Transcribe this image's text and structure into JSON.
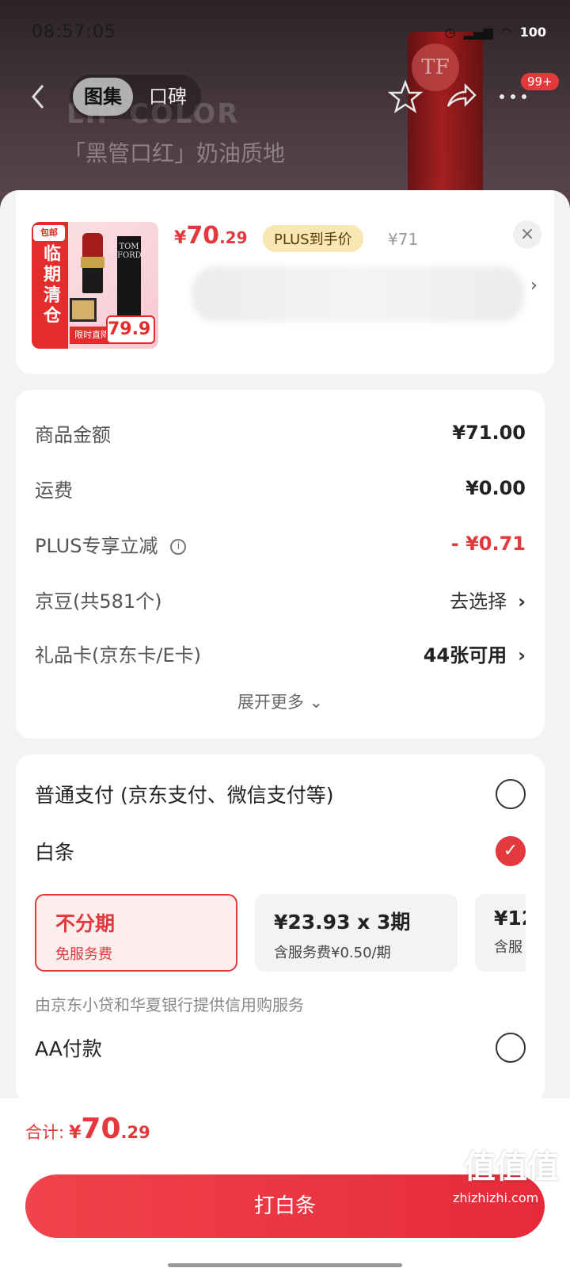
{
  "status_bar": {
    "time": "08:57:05",
    "battery": "100"
  },
  "header": {
    "tabs": [
      {
        "label": "图集"
      },
      {
        "label": "口碑"
      }
    ],
    "notifications_badge": "99+",
    "background_title_en": "LIP COLOR",
    "background_title_cn": "「黑管口红」奶油质地",
    "background_logo": "TF"
  },
  "product": {
    "price_yen": "¥",
    "price_int": "70",
    "price_dec": ".29",
    "plus_tag": "PLUS到手价",
    "original_price": "¥71",
    "image": {
      "promo_strip": "临期清仓",
      "promo_top": "包邮",
      "price_tag": "79.9",
      "time_tag": "限时直降",
      "brand": "TOM FORD"
    }
  },
  "amounts": {
    "rows": [
      {
        "label": "商品金额",
        "value": "¥71.00"
      },
      {
        "label": "运费",
        "value": "¥0.00"
      },
      {
        "label": "PLUS专享立减",
        "value": "- ¥0.71"
      },
      {
        "label": "京豆(共581个)",
        "value": "去选择"
      },
      {
        "label": "礼品卡(京东卡/E卡)",
        "value": "44张可用"
      }
    ],
    "expand_label": "展开更多"
  },
  "payment": {
    "options": [
      {
        "label": "普通支付 (京东支付、微信支付等)"
      },
      {
        "label": "白条"
      },
      {
        "label": "AA付款"
      }
    ],
    "plans": [
      {
        "title": "不分期",
        "subtitle": "免服务费"
      },
      {
        "title": "¥23.93 x 3期",
        "subtitle": "含服务费¥0.50/期"
      },
      {
        "title": "¥12",
        "subtitle": "含服"
      }
    ],
    "credit_note": "由京东小贷和华夏银行提供信用购服务"
  },
  "footer": {
    "total_label": "合计:",
    "total_yen": "¥",
    "total_int": "70",
    "total_dec": ".29",
    "pay_button": "打白条"
  },
  "watermark": {
    "logo_text": "值值值",
    "url": "zhizhizhi.com"
  },
  "colors": {
    "accent": "#e4393c",
    "plus_gold": "#f8e7b5"
  },
  "icons": [
    "back-icon",
    "star-icon",
    "share-icon",
    "more-icon",
    "close-icon",
    "chevron-right-icon",
    "info-icon",
    "chevron-down-icon",
    "check-icon"
  ]
}
